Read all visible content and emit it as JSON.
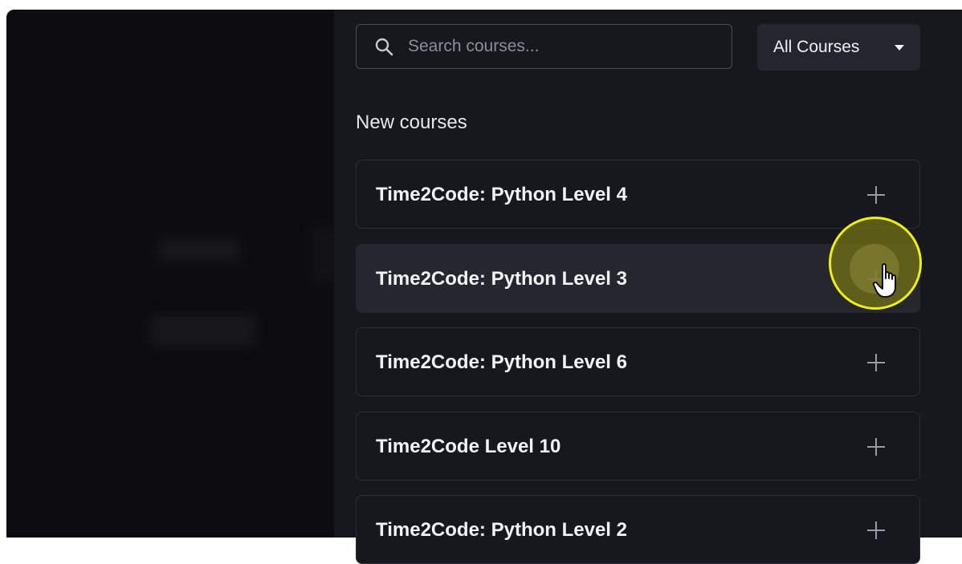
{
  "search": {
    "placeholder": "Search courses..."
  },
  "filter": {
    "selected": "All Courses"
  },
  "section": {
    "title": "New courses"
  },
  "courses": [
    {
      "title": "Time2Code: Python Level 4"
    },
    {
      "title": "Time2Code: Python Level 3"
    },
    {
      "title": "Time2Code: Python Level 6"
    },
    {
      "title": "Time2Code Level 10"
    },
    {
      "title": "Time2Code: Python Level 2"
    }
  ],
  "icons": {
    "search": "search-icon",
    "filter_caret": "caret-down-icon",
    "add": "plus-icon",
    "cursor": "hand-pointer-icon"
  },
  "colors": {
    "panel_background": "#17171e",
    "row_hover": "#26262e",
    "cursor_highlight": "#eef014"
  }
}
